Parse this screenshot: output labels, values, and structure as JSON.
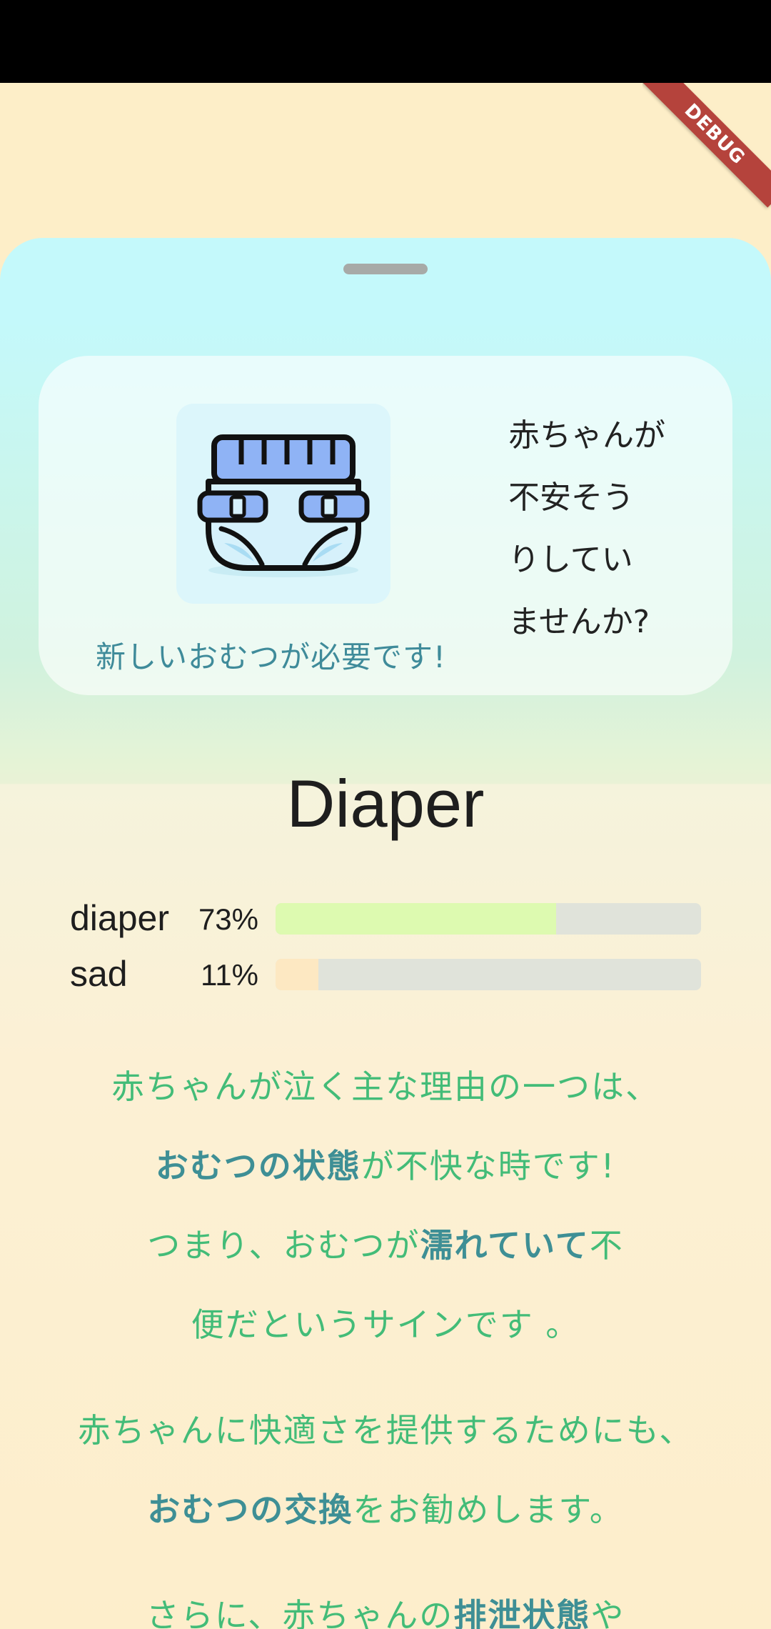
{
  "debug_banner": "DEBUG",
  "card": {
    "icon": "diaper-icon",
    "caption": "新しいおむつが必要です!",
    "question_lines": [
      "赤ちゃんが",
      "不安そう",
      "りしてい",
      "ませんか?"
    ]
  },
  "title": "Diaper",
  "stats": [
    {
      "label": "diaper",
      "percent_text": "73%",
      "value": 0.66,
      "color": "#ddfab0"
    },
    {
      "label": "sad",
      "percent_text": "11%",
      "value": 0.1,
      "color": "#fde8c2"
    }
  ],
  "body": {
    "p1": {
      "l1": "赤ちゃんが泣く主な理由の一つは、",
      "l2_bold": "おむつの状態",
      "l2_rest": "が不快な時です!",
      "l3_pre": "つまり、おむつが",
      "l3_bold": "濡れていて",
      "l3_post": "不",
      "l4": "便だというサインです 。"
    },
    "p2": {
      "l1": "赤ちゃんに快適さを提供するためにも、",
      "l2_bold": "おむつの交換",
      "l2_rest": "をお勧めします。"
    },
    "p3": {
      "l1_pre": "さらに、赤ちゃんの",
      "l1_bold": "排泄状態",
      "l1_post": "や"
    }
  },
  "colors": {
    "status_bar": "#000000",
    "page_background": "#fdeec8",
    "sheet_top": "#c4f9fb",
    "accent_green": "#43bc78",
    "accent_teal": "#3e8f95",
    "debug_ribbon": "#b5433c"
  }
}
